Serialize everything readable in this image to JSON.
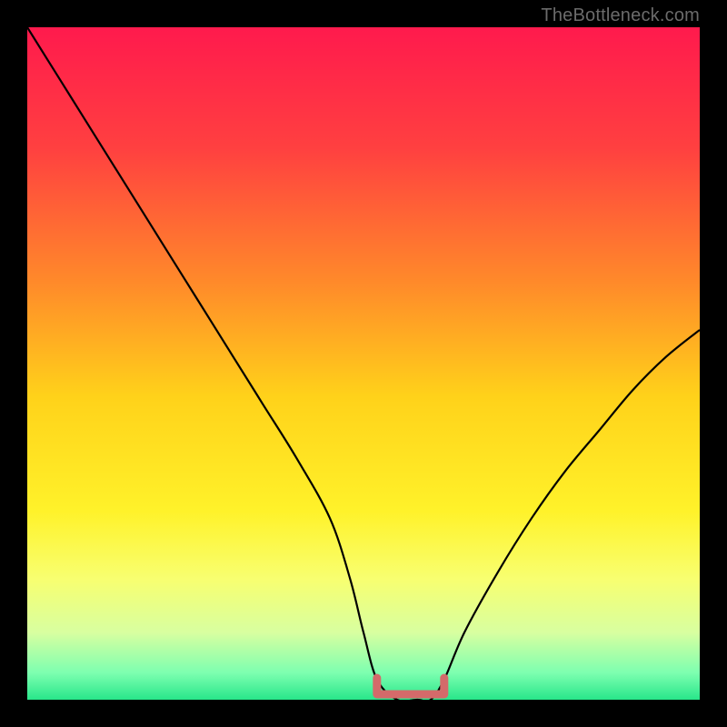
{
  "watermark": {
    "text": "TheBottleneck.com"
  },
  "colors": {
    "frame": "#000000",
    "curve": "#000000",
    "optimal_marker": "#d46a6a",
    "gradient_stops": [
      {
        "offset": 0.0,
        "color": "#ff1a4d"
      },
      {
        "offset": 0.18,
        "color": "#ff4040"
      },
      {
        "offset": 0.38,
        "color": "#ff8a2a"
      },
      {
        "offset": 0.55,
        "color": "#ffd21a"
      },
      {
        "offset": 0.72,
        "color": "#fff22a"
      },
      {
        "offset": 0.82,
        "color": "#f8ff70"
      },
      {
        "offset": 0.9,
        "color": "#d8ffa0"
      },
      {
        "offset": 0.96,
        "color": "#7dffb0"
      },
      {
        "offset": 1.0,
        "color": "#28e68a"
      }
    ]
  },
  "chart_data": {
    "type": "line",
    "title": "",
    "xlabel": "",
    "ylabel": "",
    "xlim": [
      0,
      100
    ],
    "ylim": [
      0,
      100
    ],
    "y_inverted_display": true,
    "series": [
      {
        "name": "bottleneck-curve",
        "x": [
          0,
          5,
          10,
          15,
          20,
          25,
          30,
          35,
          40,
          45,
          48,
          50,
          52,
          55,
          58,
          60,
          62,
          65,
          70,
          75,
          80,
          85,
          90,
          95,
          100
        ],
        "values": [
          100,
          92,
          84,
          76,
          68,
          60,
          52,
          44,
          36,
          27,
          18,
          10,
          3,
          0,
          0,
          0,
          3,
          10,
          19,
          27,
          34,
          40,
          46,
          51,
          55
        ]
      }
    ],
    "optimal_range": {
      "x_start": 52,
      "x_end": 62,
      "y": 0
    },
    "annotations": []
  }
}
